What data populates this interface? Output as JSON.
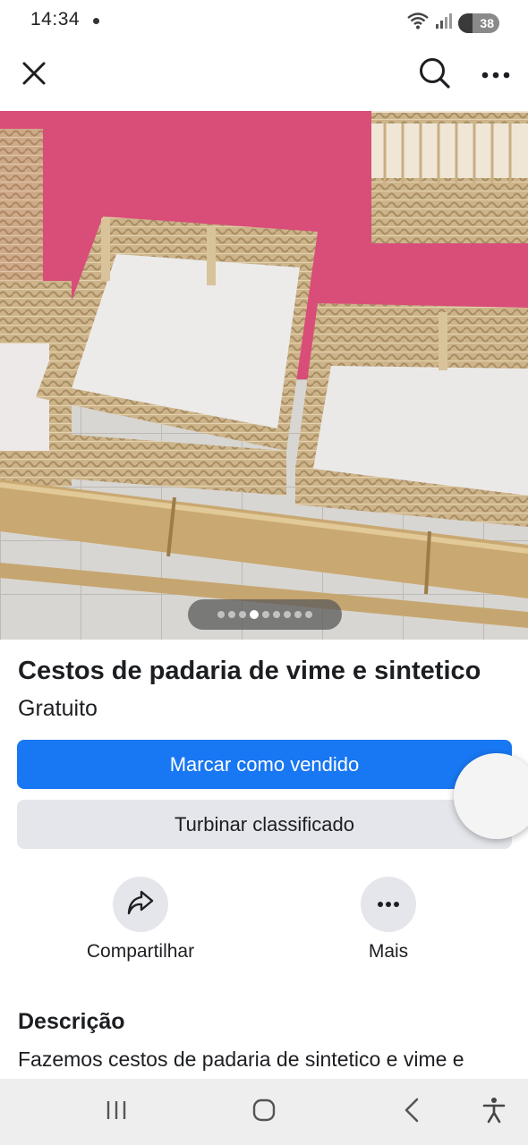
{
  "status_bar": {
    "time": "14:34",
    "battery": "38"
  },
  "top_bar": {
    "icons": [
      "close-icon",
      "search-icon",
      "more-horizontal-icon"
    ]
  },
  "photo": {
    "total_images": 9,
    "active_index": 4
  },
  "listing": {
    "title": "Cestos de padaria de vime e sintetico",
    "price": "Gratuito"
  },
  "buttons": {
    "mark_sold": "Marcar como vendido",
    "boost": "Turbinar classificado"
  },
  "actions": {
    "share_label": "Compartilhar",
    "more_label": "Mais"
  },
  "description": {
    "heading": "Descrição",
    "text": "Fazemos cestos de padaria de sintetico e vime e"
  },
  "colors": {
    "primary": "#1877f2",
    "secondary_bg": "#e4e6eb"
  }
}
